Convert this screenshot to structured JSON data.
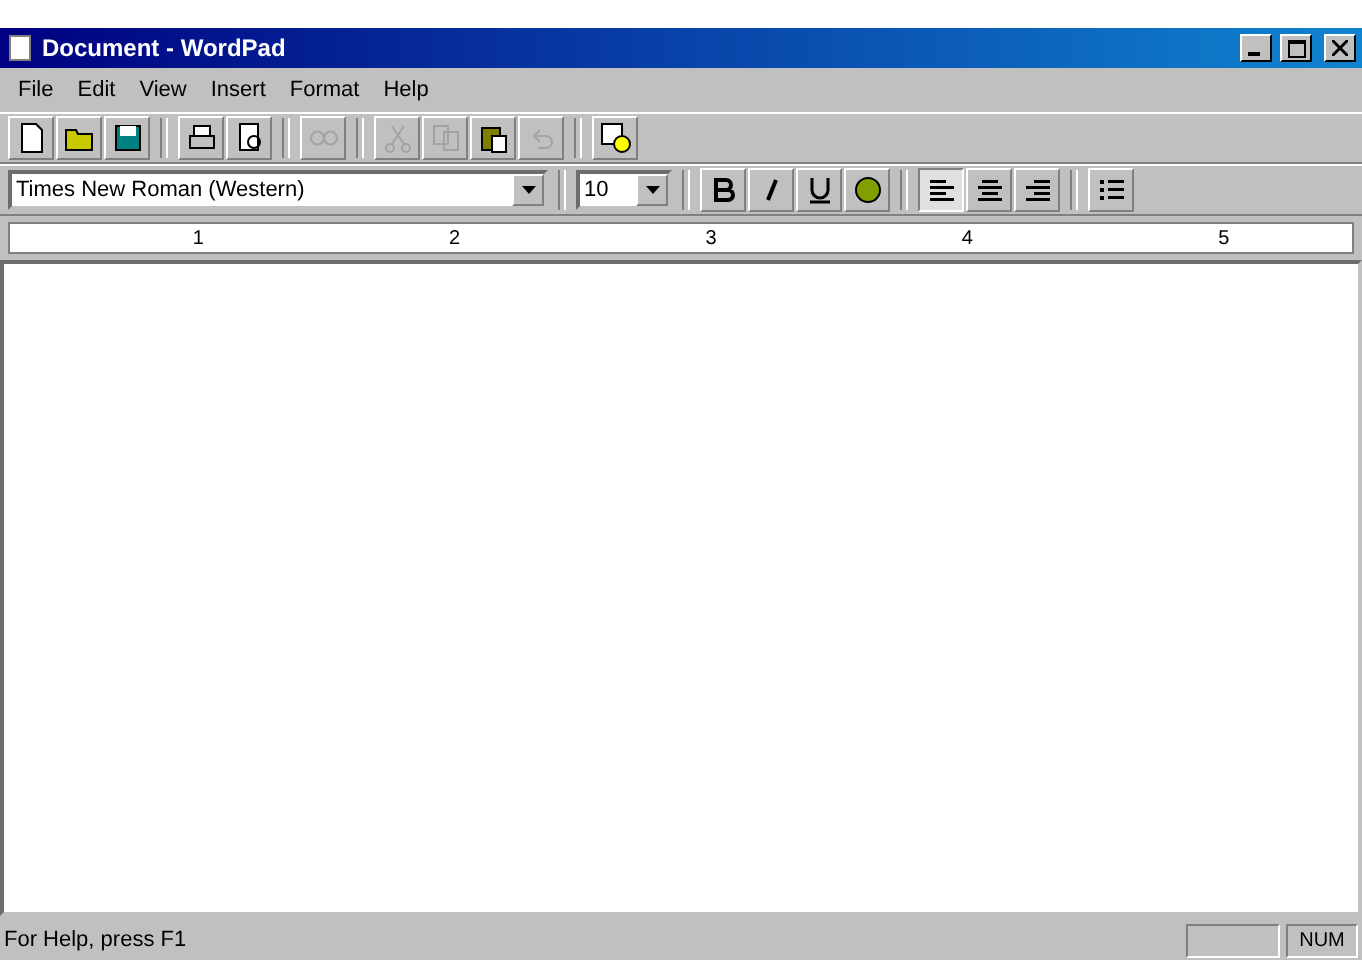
{
  "window": {
    "title": "Document - WordPad"
  },
  "menu": [
    "File",
    "Edit",
    "View",
    "Insert",
    "Format",
    "Help"
  ],
  "toolbar": [
    {
      "kind": "new",
      "disabled": false
    },
    {
      "kind": "open",
      "disabled": false
    },
    {
      "kind": "save",
      "disabled": false
    },
    {
      "kind": "sep"
    },
    {
      "kind": "print",
      "disabled": false
    },
    {
      "kind": "preview",
      "disabled": false
    },
    {
      "kind": "sep"
    },
    {
      "kind": "find",
      "disabled": true
    },
    {
      "kind": "sep"
    },
    {
      "kind": "cut",
      "disabled": true
    },
    {
      "kind": "copy",
      "disabled": true
    },
    {
      "kind": "paste",
      "disabled": false
    },
    {
      "kind": "undo",
      "disabled": true
    },
    {
      "kind": "sep"
    },
    {
      "kind": "datetime",
      "disabled": false
    }
  ],
  "format_bar": {
    "font": "Times New Roman (Western)",
    "size": "10",
    "buttons": [
      {
        "kind": "bold",
        "selected": false
      },
      {
        "kind": "italic",
        "selected": false
      },
      {
        "kind": "underline",
        "selected": false
      },
      {
        "kind": "color",
        "selected": false
      },
      {
        "kind": "sep"
      },
      {
        "kind": "left",
        "selected": true
      },
      {
        "kind": "center",
        "selected": false
      },
      {
        "kind": "right",
        "selected": false
      },
      {
        "kind": "sep"
      },
      {
        "kind": "bullets",
        "selected": false
      }
    ]
  },
  "ruler": [
    "1",
    "2",
    "3",
    "4",
    "5"
  ],
  "status_bar": {
    "text": "For Help, press F1",
    "indicator": "NUM"
  }
}
